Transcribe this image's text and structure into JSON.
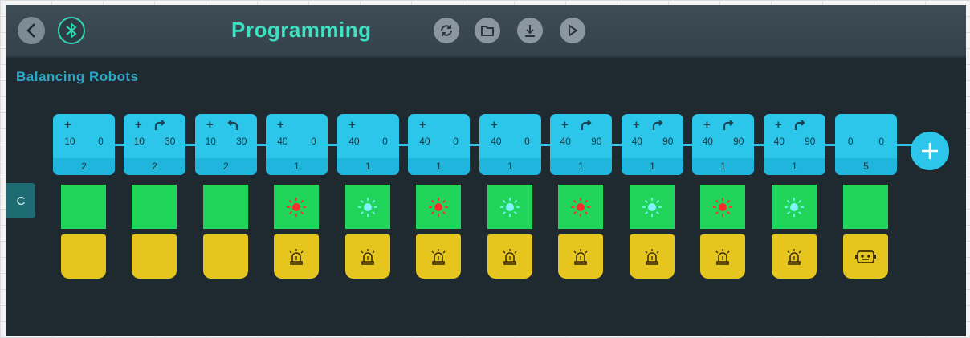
{
  "header": {
    "title": "Programming",
    "back_icon": "chevron-left-icon",
    "bluetooth_icon": "bluetooth-icon",
    "toolbar_icons": [
      "refresh-icon",
      "folder-icon",
      "download-icon",
      "play-icon"
    ]
  },
  "program": {
    "name": "Balancing Robots",
    "tab_label": "C"
  },
  "colors": {
    "accent": "#3de0c0",
    "block": "#2cc6ea",
    "led_panel": "#21d45a",
    "sound_panel": "#e6c51e",
    "led_red": "#ff2a2a",
    "led_cyan": "#7ff4ff"
  },
  "blocks": [
    {
      "direction": "+",
      "turn": "",
      "v1": "10",
      "v2": "0",
      "count": "2",
      "led": "off",
      "sound": "none"
    },
    {
      "direction": "+",
      "turn": "right",
      "v1": "10",
      "v2": "30",
      "count": "2",
      "led": "off",
      "sound": "none"
    },
    {
      "direction": "+",
      "turn": "left",
      "v1": "10",
      "v2": "30",
      "count": "2",
      "led": "off",
      "sound": "none"
    },
    {
      "direction": "+",
      "turn": "",
      "v1": "40",
      "v2": "0",
      "count": "1",
      "led": "red",
      "sound": "siren"
    },
    {
      "direction": "+",
      "turn": "",
      "v1": "40",
      "v2": "0",
      "count": "1",
      "led": "cyan",
      "sound": "siren"
    },
    {
      "direction": "+",
      "turn": "",
      "v1": "40",
      "v2": "0",
      "count": "1",
      "led": "red",
      "sound": "siren"
    },
    {
      "direction": "+",
      "turn": "",
      "v1": "40",
      "v2": "0",
      "count": "1",
      "led": "cyan",
      "sound": "siren"
    },
    {
      "direction": "+",
      "turn": "right",
      "v1": "40",
      "v2": "90",
      "count": "1",
      "led": "red",
      "sound": "siren"
    },
    {
      "direction": "+",
      "turn": "right",
      "v1": "40",
      "v2": "90",
      "count": "1",
      "led": "cyan",
      "sound": "siren"
    },
    {
      "direction": "+",
      "turn": "right",
      "v1": "40",
      "v2": "90",
      "count": "1",
      "led": "red",
      "sound": "siren"
    },
    {
      "direction": "+",
      "turn": "right",
      "v1": "40",
      "v2": "90",
      "count": "1",
      "led": "cyan",
      "sound": "siren"
    },
    {
      "direction": "",
      "turn": "",
      "v1": "0",
      "v2": "0",
      "count": "5",
      "led": "off",
      "sound": "robot"
    }
  ],
  "add_button_icon": "plus-icon"
}
